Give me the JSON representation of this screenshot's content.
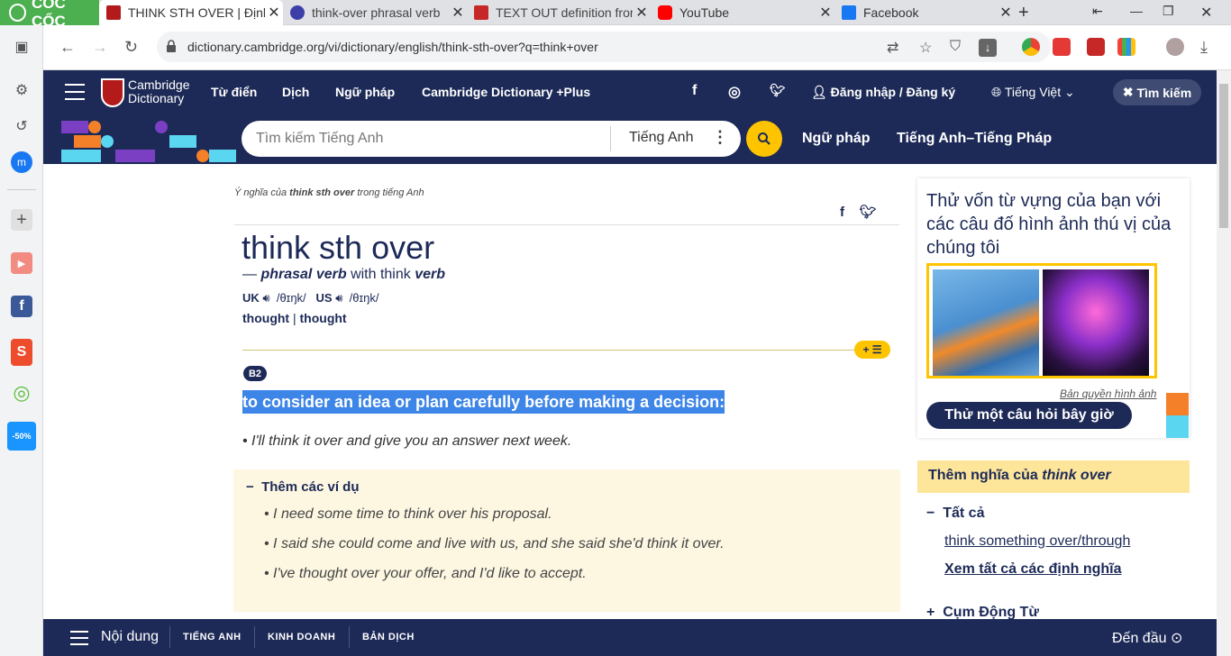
{
  "browser": {
    "brand": "CỐC CỐC",
    "tabs": [
      {
        "title": "THINK STH OVER | Định nghĩa",
        "fav_color": "#b31b1b"
      },
      {
        "title": "think-over phrasal verb",
        "fav_color": "#3c3fa8"
      },
      {
        "title": "TEXT OUT definition from",
        "fav_color": "#c62828"
      },
      {
        "title": "YouTube",
        "fav_color": "#ff0000"
      },
      {
        "title": "Facebook",
        "fav_color": "#1877f2"
      }
    ],
    "url": "dictionary.cambridge.org/vi/dictionary/english/think-sth-over?q=think+over"
  },
  "header": {
    "logo_line1": "Cambridge",
    "logo_line2": "Dictionary",
    "nav": [
      "Từ điển",
      "Dịch",
      "Ngữ pháp",
      "Cambridge Dictionary +Plus"
    ],
    "login": "Đăng nhập / Đăng ký",
    "language": "Tiếng Việt",
    "search_button": "Tìm kiếm"
  },
  "search": {
    "placeholder": "Tìm kiếm Tiếng Anh",
    "dictionary": "Tiếng Anh",
    "links": [
      "Ngữ pháp",
      "Tiếng Anh–Tiếng Pháp"
    ]
  },
  "entry": {
    "crumb_prefix": "Ý nghĩa của",
    "crumb_word": "think sth over",
    "crumb_suffix": "trong tiếng Anh",
    "headword": "think sth over",
    "pos_dash": "—",
    "pos": "phrasal verb",
    "pos_with": "with think",
    "pos_verb": "verb",
    "uk_label": "UK",
    "uk_ipa": "/θɪŋk/",
    "us_label": "US",
    "us_ipa": "/θɪŋk/",
    "form1": "thought",
    "form_sep": "|",
    "form2": "thought",
    "level": "B2",
    "definition": "to consider an idea or plan carefully before making a decision:",
    "example": "I'll think it over and give you an answer next week.",
    "more_examples_title": "Thêm các ví dụ",
    "more_examples": [
      "I need some time to think over his proposal.",
      "I said she could come and live with us, and she said she'd think it over.",
      "I've thought over your offer, and I'd like to accept."
    ]
  },
  "sidebar": {
    "quiz_title": "Thử vốn từ vựng của bạn với các câu đố hình ảnh thú vị của chúng tôi",
    "credit": "Bản quyền hình ảnh",
    "quiz_button": "Thử một câu hỏi bây giờ",
    "more_meanings_prefix": "Thêm nghĩa của",
    "more_meanings_word": "think over",
    "all_label": "Tất cả",
    "link1": "think something over/through",
    "link2": "Xem tất cả các định nghĩa",
    "phrasal_label": "Cụm Động Từ"
  },
  "bottombar": {
    "contents": "Nội dung",
    "links": [
      "TIẾNG ANH",
      "KINH DOANH",
      "BẢN DỊCH"
    ],
    "back_to_top": "Đến đầu"
  }
}
